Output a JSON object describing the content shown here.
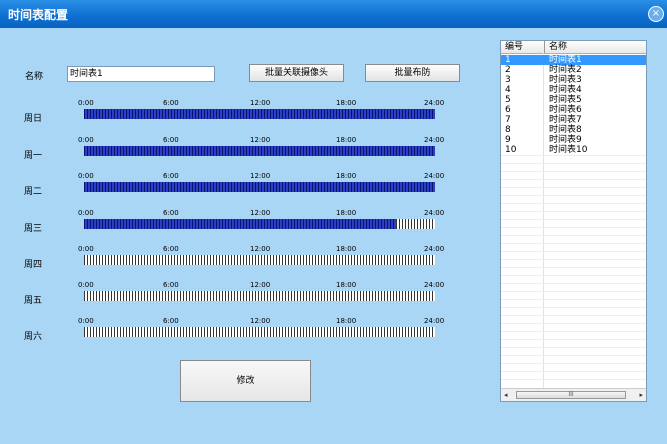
{
  "window": {
    "title": "时间表配置",
    "close_label": "×"
  },
  "form": {
    "name_label": "名称",
    "name_value": "时间表1",
    "batch_camera_button": "批量关联摄像头",
    "batch_arm_button": "批量布防",
    "modify_button": "修改"
  },
  "ticks": [
    "0:00",
    "6:00",
    "12:00",
    "18:00",
    "24:00"
  ],
  "schedule": [
    {
      "day": "周日",
      "coverage": 1.0
    },
    {
      "day": "周一",
      "coverage": 1.0
    },
    {
      "day": "周二",
      "coverage": 1.0
    },
    {
      "day": "周三",
      "coverage": 0.89
    },
    {
      "day": "周四",
      "coverage": 0.0
    },
    {
      "day": "周五",
      "coverage": 0.0
    },
    {
      "day": "周六",
      "coverage": 0.0
    }
  ],
  "list": {
    "col_id": "编号",
    "col_name": "名称",
    "rows": [
      {
        "id": "1",
        "name": "时间表1",
        "selected": true
      },
      {
        "id": "2",
        "name": "时间表2"
      },
      {
        "id": "3",
        "name": "时间表3"
      },
      {
        "id": "4",
        "name": "时间表4"
      },
      {
        "id": "5",
        "name": "时间表5"
      },
      {
        "id": "6",
        "name": "时间表6"
      },
      {
        "id": "7",
        "name": "时间表7"
      },
      {
        "id": "8",
        "name": "时间表8"
      },
      {
        "id": "9",
        "name": "时间表9"
      },
      {
        "id": "10",
        "name": "时间表10"
      }
    ],
    "scroll_thumb": "III",
    "scroll_left": "◂",
    "scroll_right": "▸"
  }
}
